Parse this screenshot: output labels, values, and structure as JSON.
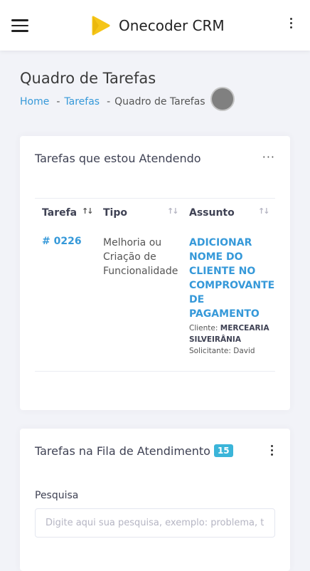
{
  "header": {
    "menu_icon": "hamburger-icon",
    "logo_icon": "onecoder-logo-icon",
    "app_name": "Onecoder CRM",
    "more_icon": "more-vertical-icon",
    "colors": {
      "logo": "#f5c518",
      "background": "#ffffff"
    }
  },
  "page": {
    "title": "Quadro de Tarefas",
    "breadcrumb": [
      {
        "label": "Home",
        "link": true
      },
      {
        "label": "Tarefas",
        "link": true
      },
      {
        "label": "Quadro de Tarefas",
        "link": false
      }
    ],
    "breadcrumb_separator": "-"
  },
  "attending_card": {
    "title": "Tarefas que estou Atendendo",
    "menu_label": "···",
    "columns": [
      "Tarefa",
      "Tipo",
      "Assunto"
    ],
    "sort_icon": "↑↓",
    "rows": [
      {
        "number": "# 0226",
        "type": "Melhoria ou Criação de Funcionalidade",
        "subject": "ADICIONAR NOME DO CLIENTE NO COMPROVANTE DE PAGAMENTO",
        "client_label": "Cliente:",
        "client_name": "MERCEARIA SILVEIRÂNIA",
        "requester_label": "Solicitante:",
        "requester_name": "David"
      }
    ]
  },
  "queue_card": {
    "title": "Tarefas na Fila de Atendimento",
    "count": "15",
    "search_label": "Pesquisa",
    "search_placeholder": "Digite aqui sua pesquisa, exemplo: problema, tela, cliente",
    "search_value": ""
  },
  "colors": {
    "accent": "#3699d9",
    "badge": "#3bb5d9",
    "page_bg": "#f2f3f8"
  }
}
